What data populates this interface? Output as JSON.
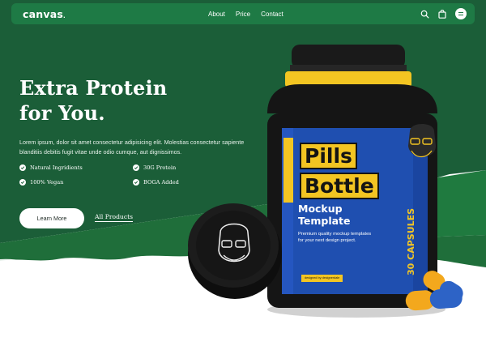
{
  "nav": {
    "logo": "canvas",
    "links": [
      "About",
      "Price",
      "Contact"
    ],
    "icons": [
      "search-icon",
      "bag-icon",
      "menu-icon"
    ]
  },
  "hero": {
    "headline_line1": "Extra Protein",
    "headline_line2": "for You.",
    "description": "Lorem ipsum, dolor sit amet consectetur adipisicing elit. Molestias consectetur sapiente blanditiis debitis fugit vitae unde odio cumque, aut dignissimos.",
    "features": [
      "Natural Ingridients",
      "30G Protein",
      "100% Vegan",
      "BOGA Added"
    ],
    "cta_primary": "Learn More",
    "cta_secondary": "All Products"
  },
  "product": {
    "label_line1": "Pills",
    "label_line2": "Bottle",
    "mockup_line1": "Mockup",
    "mockup_line2": "Template",
    "premium_line1": "Premium quality mockup templates",
    "premium_line2": "for your next design project.",
    "capsules": "30 CAPSULES",
    "designed": "designed by designerdale"
  },
  "colors": {
    "dark_green": "#1b5e38",
    "nav_green": "#1e7a45",
    "accent_green": "#1f7a3f",
    "bottle_blue": "#1f4fb0",
    "yellow": "#f3c522",
    "black": "#141414"
  }
}
